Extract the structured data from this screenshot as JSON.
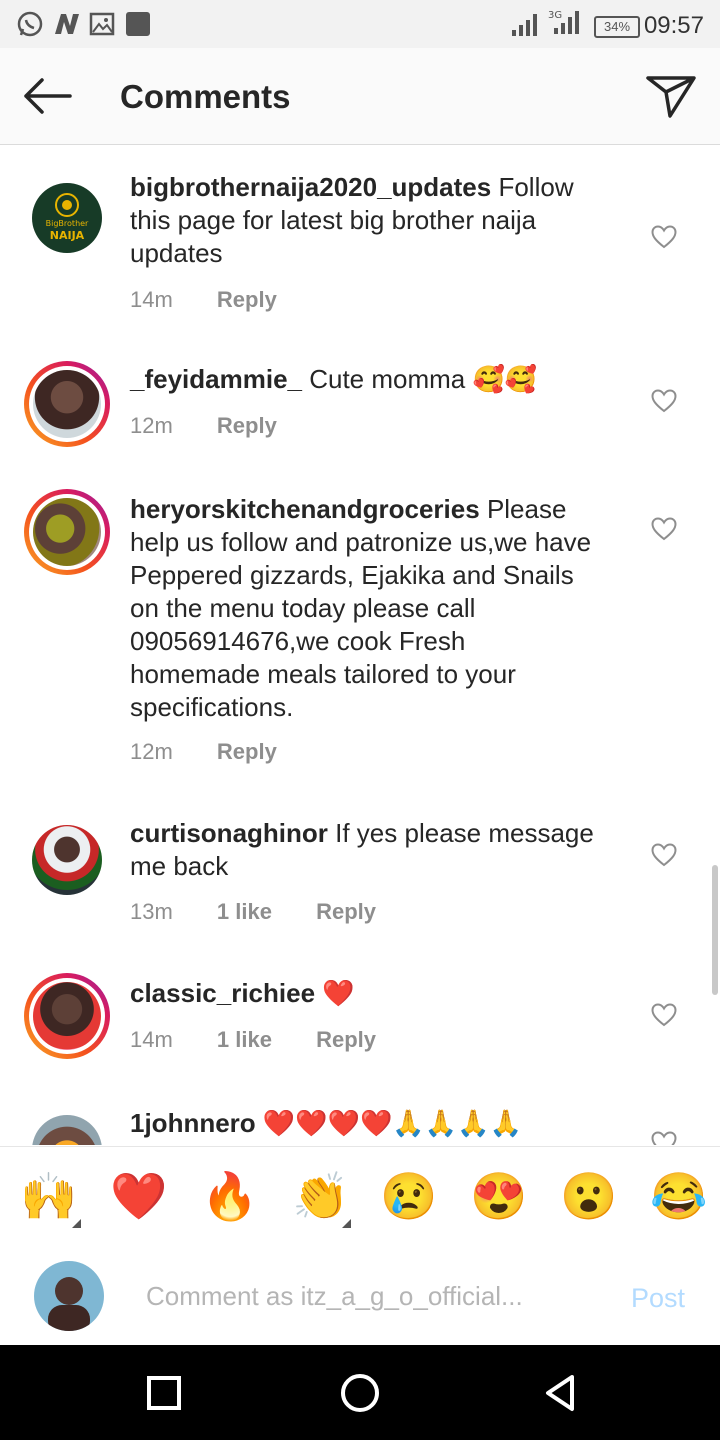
{
  "status_bar": {
    "time": "09:57",
    "battery": "34%",
    "network": "3G",
    "icons": [
      "whatsapp-icon",
      "n-app-icon",
      "gallery-icon",
      "app-icon",
      "signal-icon",
      "battery-icon"
    ]
  },
  "header": {
    "title": "Comments",
    "back_icon": "arrow-left-icon",
    "share_icon": "paper-plane-icon"
  },
  "comments": [
    {
      "username": "bigbrothernaija2020_updates",
      "text": "Follow this page for latest big brother naija updates",
      "time": "14m",
      "likes": "",
      "reply": "Reply",
      "avatar_text": [
        "BigBrother",
        "NAIJA"
      ]
    },
    {
      "username": "_feyidammie_",
      "text": "Cute momma 🥰🥰",
      "time": "12m",
      "likes": "",
      "reply": "Reply"
    },
    {
      "username": "heryorskitchenandgroceries",
      "text": "Please help us follow and patronize us,we have Peppered gizzards, Ejakika and Snails on the menu today please call 09056914676,we cook Fresh homemade meals tailored to your specifications.",
      "time": "12m",
      "likes": "",
      "reply": "Reply"
    },
    {
      "username": "curtisonaghinor",
      "text": "If yes please message me back",
      "time": "13m",
      "likes": "1 like",
      "reply": "Reply"
    },
    {
      "username": "classic_richiee",
      "text": "❤️",
      "time": "14m",
      "likes": "1 like",
      "reply": "Reply"
    },
    {
      "username": "1johnnero",
      "text": "❤️❤️❤️❤️🙏🙏🙏🙏",
      "time": "",
      "likes": "",
      "reply": ""
    }
  ],
  "emoji_bar": [
    "🙌",
    "❤️",
    "🔥",
    "👏",
    "😢",
    "😍",
    "😮",
    "😂"
  ],
  "composer": {
    "placeholder": "Comment as itz_a_g_o_official...",
    "post_label": "Post"
  },
  "colors": {
    "post_disabled": "#b3dbff",
    "heart_outline": "#8e8e8e",
    "meta_text": "#8e8e8e",
    "story_ring": "#d81b60"
  }
}
